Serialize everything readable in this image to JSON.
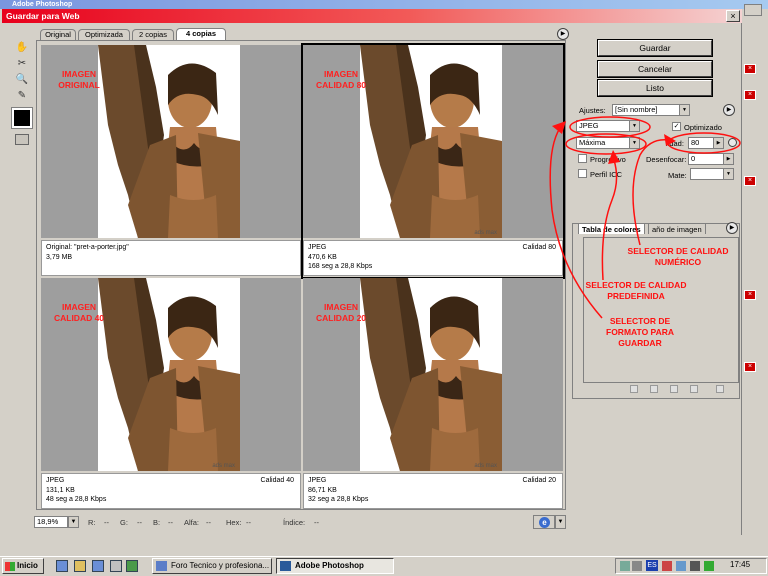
{
  "app_title": "Adobe Photoshop",
  "dialog": {
    "title": "Guardar para Web",
    "close_glyph": "×"
  },
  "tabs": [
    "Original",
    "Optimizada",
    "2 copias",
    "4 copias"
  ],
  "panes": [
    {
      "label": "IMAGEN ORIGINAL",
      "line1": "Original: \"pret-a-porter.jpg\"",
      "line2": "3,79 MB",
      "line3": "",
      "quality": "",
      "watermark": ""
    },
    {
      "label": "IMAGEN CALIDAD 80",
      "line1": "JPEG",
      "line2": "470,6 KB",
      "line3": "168 seg a 28,8 Kbps",
      "quality": "Calidad 80",
      "watermark": "ads max"
    },
    {
      "label": "IMAGEN CALIDAD 40",
      "line1": "JPEG",
      "line2": "131,1 KB",
      "line3": "48 seg a 28,8 Kbps",
      "quality": "Calidad 40",
      "watermark": "ads max"
    },
    {
      "label": "IMAGEN CALIDAD 20",
      "line1": "JPEG",
      "line2": "86,71 KB",
      "line3": "32 seg a 28,8 Kbps",
      "quality": "Calidad 20",
      "watermark": "ads max"
    }
  ],
  "status": {
    "zoom": "18,9%",
    "r": "R:",
    "r_val": "--",
    "g": "G:",
    "g_val": "--",
    "b": "B:",
    "b_val": "--",
    "alfa": "Alfa:",
    "alfa_val": "--",
    "hex": "Hex:",
    "hex_val": "--",
    "indice": "Índice:",
    "indice_val": "--"
  },
  "buttons": {
    "save": "Guardar",
    "cancel": "Cancelar",
    "done": "Listo"
  },
  "settings": {
    "preset_label": "Ajustes:",
    "preset_value": "[Sin nombre]",
    "format": "JPEG",
    "optimized_label": "Optimizado",
    "quality_preset": "Máxima",
    "quality_label": "lidad:",
    "quality_value": "80",
    "progressive_label": "Progresivo",
    "blur_label": "Desenfocar:",
    "blur_value": "0",
    "icc_label": "Perfil ICC",
    "matte_label": "Mate:"
  },
  "panel_tabs": {
    "color_table": "Tabla de colores",
    "image_size": "año de imagen"
  },
  "annotations": {
    "numeric": "SELECTOR DE CALIDAD NUMÉRICO",
    "preset": "SELECTOR DE CALIDAD PREDEFINIDA",
    "format": "SELECTOR DE FORMATO PARA GUARDAR"
  },
  "taskbar": {
    "start": "Inicio",
    "task1": "Foro Tecnico y profesiona...",
    "task2": "Adobe Photoshop",
    "lang": "ES",
    "clock": "17:45"
  },
  "colors": {
    "dialog_title": "#e8001c",
    "annotation": "#ff1010",
    "chrome": "#d4d0c8"
  }
}
